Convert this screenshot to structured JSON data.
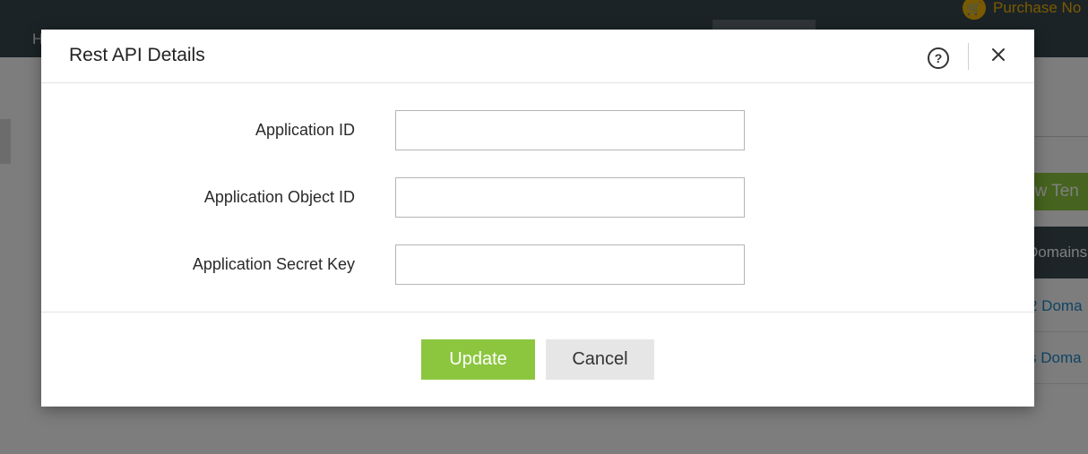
{
  "background": {
    "nav_item": "H",
    "purchase_label": "Purchase No",
    "new_tenant_label": "ew Ten",
    "table_header": "Domains",
    "rows": [
      "2 Doma",
      "s Doma"
    ]
  },
  "modal": {
    "title": "Rest API Details",
    "help_icon_glyph": "?",
    "fields": [
      {
        "label": "Application ID",
        "value": "",
        "placeholder": ""
      },
      {
        "label": "Application Object ID",
        "value": "",
        "placeholder": ""
      },
      {
        "label": "Application Secret Key",
        "value": "",
        "placeholder": ""
      }
    ],
    "buttons": {
      "update": "Update",
      "cancel": "Cancel"
    }
  },
  "icons": {
    "help": "help-circle-icon",
    "close": "close-icon",
    "cart": "cart-icon"
  },
  "colors": {
    "topbar": "#37474f",
    "accent_green": "#8cc63f",
    "purchase_yellow": "#f2b400",
    "link_blue": "#1e88c8",
    "cancel_gray": "#e6e6e6"
  }
}
